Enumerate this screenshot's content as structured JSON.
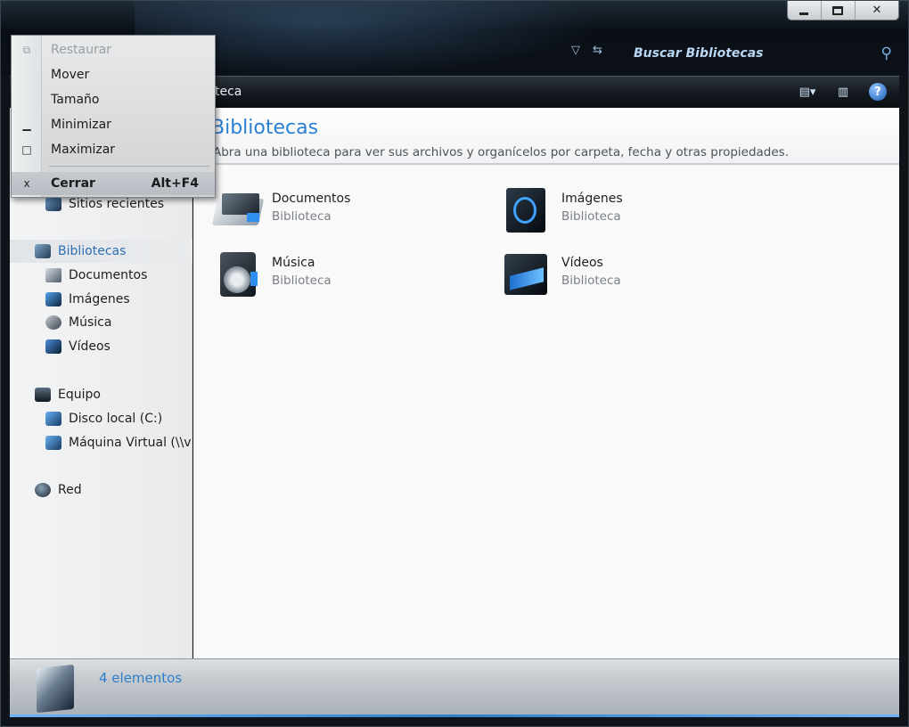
{
  "window": {
    "buttons": {
      "minimize": "",
      "maximize": "",
      "close": "✕"
    }
  },
  "search": {
    "placeholder": "Buscar Bibliotecas"
  },
  "toolbar": {
    "crumb_fragment": "teca"
  },
  "sidebar": {
    "partial_item": "Sitios recientes",
    "libraries_header": "Bibliotecas",
    "library_items": [
      "Documentos",
      "Imágenes",
      "Música",
      "Vídeos"
    ],
    "computer_header": "Equipo",
    "computer_items": [
      "Disco local (C:)",
      "Máquina Virtual (\\\\v"
    ],
    "network": "Red"
  },
  "content": {
    "title": "Bibliotecas",
    "description": "Abra una biblioteca para ver sus archivos y organícelos por carpeta, fecha y otras propiedades.",
    "libraries": [
      {
        "name": "Documentos",
        "type": "Biblioteca",
        "icon": "documents-library-icon"
      },
      {
        "name": "Imágenes",
        "type": "Biblioteca",
        "icon": "pictures-library-icon"
      },
      {
        "name": "Música",
        "type": "Biblioteca",
        "icon": "music-library-icon"
      },
      {
        "name": "Vídeos",
        "type": "Biblioteca",
        "icon": "videos-library-icon"
      }
    ]
  },
  "statusbar": {
    "count": "4 elementos"
  },
  "system_menu": {
    "items": [
      {
        "label": "Restaurar",
        "shortcut": "",
        "glyph": "⧉"
      },
      {
        "label": "Mover",
        "shortcut": "",
        "glyph": ""
      },
      {
        "label": "Tamaño",
        "shortcut": "",
        "glyph": ""
      },
      {
        "label": "Minimizar",
        "shortcut": "",
        "glyph": "▁"
      },
      {
        "label": "Maximizar",
        "shortcut": "",
        "glyph": "□"
      },
      {
        "label": "Cerrar",
        "shortcut": "Alt+F4",
        "glyph": "x"
      }
    ]
  },
  "colors": {
    "accent": "#2d7fd1",
    "frame": "#0f141b",
    "status_text": "#2f7ec9"
  }
}
